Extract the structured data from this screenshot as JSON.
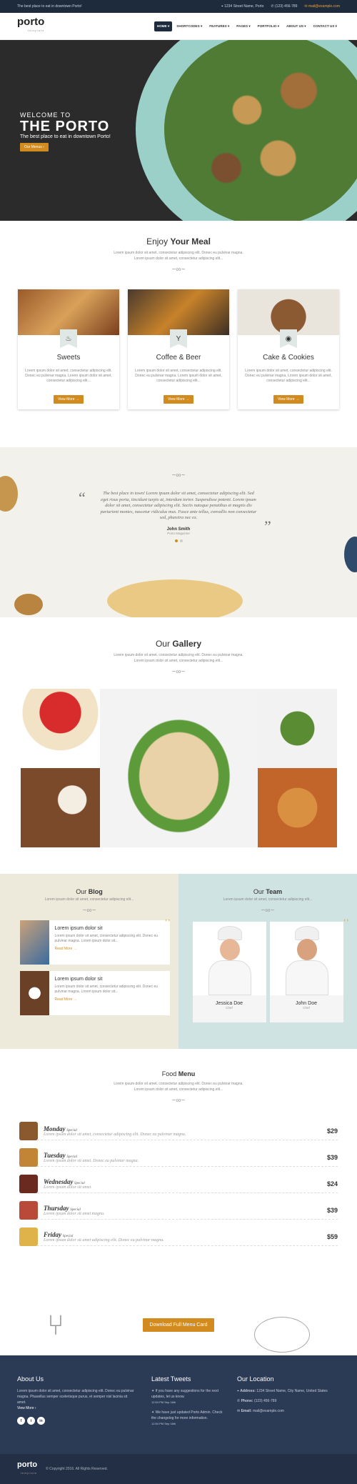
{
  "topbar": {
    "tagline": "The best place to eat in downtown Porto!",
    "address": "1234 Street Name, Porto",
    "phone": "(123) 456-789",
    "email": "mail@example.com"
  },
  "header": {
    "logo": "porto",
    "logo_sub": "template",
    "nav": [
      "HOME",
      "SHORTCODES",
      "FEATURES",
      "PAGES",
      "PORTFOLIO",
      "ABOUT US",
      "CONTACT US"
    ]
  },
  "hero": {
    "welcome": "WELCOME TO",
    "title": "THE PORTO",
    "subtitle": "The best place to eat in downtown Porto!",
    "button": "Our Menus"
  },
  "meal": {
    "title_light": "Enjoy",
    "title_bold": "Your Meal",
    "lines": [
      "Lorem ipsum dolor sit amet, consectetur adipiscing elit. Donec eu pulvinar magna.",
      "Lorem ipsum dolor sit amet, consectetur adipiscing elit..."
    ],
    "cards": [
      {
        "title": "Sweets",
        "text": "Lorem ipsum dolor sit amet, consectetur adipiscing elit. Donec eu pulvinar magna. Lorem ipsum dolor sit amet, consectetur adipiscing elit...",
        "button": "View More"
      },
      {
        "title": "Coffee & Beer",
        "text": "Lorem ipsum dolor sit amet, consectetur adipiscing elit. Donec eu pulvinar magna. Lorem ipsum dolor sit amet, consectetur adipiscing elit...",
        "button": "View More"
      },
      {
        "title": "Cake & Cookies",
        "text": "Lorem ipsum dolor sit amet, consectetur adipiscing elit. Donec eu pulvinar magna. Lorem ipsum dolor sit amet, consectetur adipiscing elit...",
        "button": "View More"
      }
    ]
  },
  "testimonial": {
    "quote": "The best place in town! Lorem ipsum dolor sit amet, consectetur adipiscing elit. Sed eget risus porta, tincidunt turpis at, interdum tortor. Suspendisse potenti. Lorem ipsum dolor sit amet, consectetur adipiscing elit. Sociis natoque penatibus et magnis dis parturient montes, nascetur ridiculus mus. Fusce ante tellus, convallis non consectetur sed, pharetra nec ex.",
    "name": "John Smith",
    "role": "Porto Magazine"
  },
  "gallery": {
    "title_light": "Our",
    "title_bold": "Gallery",
    "lines": [
      "Lorem ipsum dolor sit amet, consectetur adipiscing elit. Donec eu pulvinar magna.",
      "Lorem ipsum dolor sit amet, consectetur adipiscing elit..."
    ]
  },
  "blog": {
    "title_light": "Our",
    "title_bold": "Blog",
    "sub": "Lorem ipsum dolor sit amet, consectetur adipiscing elit...",
    "posts": [
      {
        "title": "Lorem ipsum dolor sit",
        "text": "Lorem ipsum dolor sit amet, consectetur adipiscing elit. Donec eu pulvinar magna. Lorem ipsum dolor sit...",
        "more": "Read More"
      },
      {
        "title": "Lorem ipsum dolor sit",
        "text": "Lorem ipsum dolor sit amet, consectetur adipiscing elit. Donec eu pulvinar magna. Lorem ipsum dolor sit...",
        "more": "Read More"
      }
    ]
  },
  "team": {
    "title_light": "Our",
    "title_bold": "Team",
    "sub": "Lorem ipsum dolor sit amet, consectetur adipiscing elit...",
    "members": [
      {
        "name": "Jessica Doe",
        "role": "Chef"
      },
      {
        "name": "John Doe",
        "role": "Chef"
      }
    ]
  },
  "food": {
    "title_light": "Food",
    "title_bold": "Menu",
    "lines": [
      "Lorem ipsum dolor sit amet, consectetur adipiscing elit. Donec eu pulvinar magna.",
      "Lorem ipsum dolor sit amet, consectetur adipiscing elit..."
    ],
    "items": [
      {
        "day": "Monday",
        "tag": "Special",
        "desc": "Lorem ipsum dolor sit amet, consectetur adipiscing elit. Donec eu pulvinar magna.",
        "price": "$29"
      },
      {
        "day": "Tuesday",
        "tag": "Special",
        "desc": "Lorem ipsum dolor sit amet. Donec eu pulvinar magna.",
        "price": "$39"
      },
      {
        "day": "Wednesday",
        "tag": "Special",
        "desc": "Lorem ipsum dolor sit amet.",
        "price": "$24"
      },
      {
        "day": "Thursday",
        "tag": "Special",
        "desc": "Lorem ipsum dolor sit amet magna.",
        "price": "$39"
      },
      {
        "day": "Friday",
        "tag": "Special",
        "desc": "Lorem ipsum dolor sit amet adipiscing elit. Donec eu pulvinar magna.",
        "price": "$59"
      }
    ],
    "download": "Download Full Menu Card"
  },
  "footer": {
    "about_title": "About Us",
    "about_text": "Lorem ipsum dolor sit amet, consectetur adipiscing elit. Donec eu pulvinar magna. Phasellus semper scelerisque purus, et semper nisl lacinia sit amet.",
    "view_more": "View More",
    "tweets_title": "Latest Tweets",
    "tweets": [
      {
        "text": "If you have any suggestions for the next updates, let us know.",
        "time": "12:54 PM Sep 16th"
      },
      {
        "text": "We have just updated Porto Admin. Check the changelog for more information.",
        "time": "12:54 PM Sep 16th"
      }
    ],
    "loc_title": "Our Location",
    "address_label": "Address:",
    "address": "1234 Street Name, City Name, United States",
    "phone_label": "Phone:",
    "phone": "(123) 456-789",
    "email_label": "Email:",
    "email": "mail@example.com",
    "copyright": "© Copyright 2016. All Rights Reserved."
  }
}
